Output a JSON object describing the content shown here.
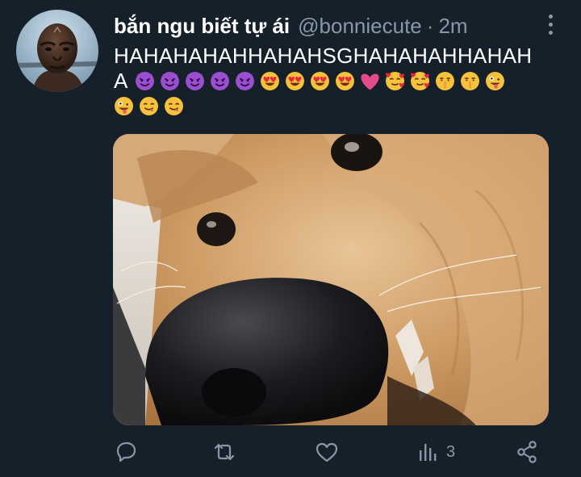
{
  "tweet": {
    "display_name": "bắn ngu biết tự ái",
    "handle": "@bonniecute",
    "separator": "·",
    "time": "2m",
    "text_line1": "HAHAHAHAHHAHAHSGHAHAHAHHAHAH",
    "text_line2_lead": "A",
    "emoji_line2": [
      "smiling-devil",
      "smiling-devil",
      "smiling-devil",
      "smiling-devil",
      "smiling-devil",
      "heart-eyes",
      "heart-eyes",
      "heart-eyes",
      "heart-eyes",
      "pink-heart",
      "smiling-hearts",
      "smiling-hearts",
      "shushing-face",
      "shushing-face",
      "zany-face"
    ],
    "emoji_line3": [
      "zany-face",
      "yum-face",
      "yum-face"
    ]
  },
  "actions": {
    "views_count": "3"
  },
  "colors": {
    "background": "#15202b",
    "secondary_text": "#8899a6"
  }
}
